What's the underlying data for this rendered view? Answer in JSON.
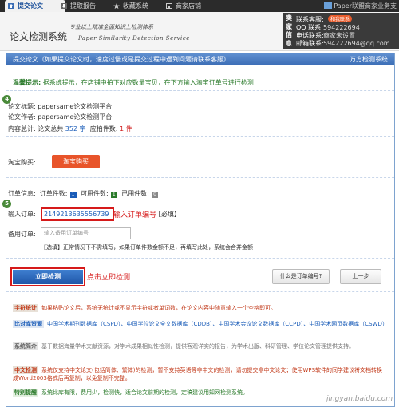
{
  "topbar": {
    "tabs": [
      {
        "label": "提交论文",
        "icon": "upload-icon",
        "active": true
      },
      {
        "label": "提取报告",
        "icon": "download-icon",
        "active": false
      },
      {
        "label": "收藏系统",
        "icon": "star-icon",
        "active": false
      },
      {
        "label": "商家店铺",
        "icon": "shop-icon",
        "active": false
      }
    ],
    "brand": "Paper联盟商家业务支"
  },
  "header": {
    "site_name": "论文检测系统",
    "slogan_cn": "专业以上精准全面知识上检测体系",
    "slogan_en": "Paper Similarity Detection Service",
    "contact": {
      "side_label": "卖家信息",
      "badge": "和我联系",
      "rows": [
        {
          "key": "联系客服:",
          "value": ""
        },
        {
          "key": "QQ 联系:",
          "value": "594222694"
        },
        {
          "key": "电话联系:",
          "value": "商家未设置"
        },
        {
          "key": "邮箱联系:",
          "value": "594222694@qq.com"
        }
      ]
    }
  },
  "panel": {
    "title": "提交论文（如果提交论文时，速度过慢或是提交过程中遇到问题请联系客服）",
    "right_label": "万方检测系统",
    "warm_tip_tag": "温馨提示:",
    "warm_tip_text": "据系统提示，在店铺中拍下对应数量宝贝，在下方输入淘宝订单号进行检测",
    "step4": "4",
    "step5": "5",
    "paper_title_label": "论文标题:",
    "paper_title_value": "papersame论文检测平台",
    "paper_author_label": "论文作者:",
    "paper_author_value": "papersame论文检测平台",
    "content_total_label": "内容总计:",
    "content_total_prefix": "论文总共",
    "content_total_chars": "352",
    "content_total_unit": "字",
    "pieces_label": "应拍件数:",
    "pieces_value": "1",
    "pieces_unit": "件",
    "taobao_label": "淘宝购买:",
    "taobao_button": "淘宝购买",
    "order_info_label": "订单信息:",
    "order_count_label": "订单件数:",
    "order_count": "1",
    "usable_label": "可用件数:",
    "usable_count": "1",
    "used_label": "已用件数:",
    "used_count": "0",
    "order_input_label": "输入订单:",
    "order_input_value": "2149213635556739",
    "order_input_hint": "输入订单编号",
    "order_required": "【必填】",
    "memo_label": "备用订单:",
    "memo_placeholder": "输入备用订单编号",
    "memo_note": "【选填】正常情况下不需填写，如果订单件数金额不足，再填写此处，系统会合并金额",
    "check_button": "立即检测",
    "check_hint": "点击立即检测",
    "what_button": "什么是订单编号?",
    "prev_button": "上一步"
  },
  "info": [
    {
      "tag": "字符统计",
      "text": "如果粘贴论文后，系统无统计或不显示字符或者单词数，在论文内容中随意输入一个空格即可。",
      "style": "red"
    },
    {
      "tag": "比对库资源",
      "text": "中国学术期刊数据库（CSPD）、中国学位论文全文数据库（CDDB）、中国学术会议论文数据库（CCPD）、中国学术网页数据库（CSWD）",
      "style": "blue"
    },
    {
      "tag": "系统简介",
      "text": "基于数据海量学术文献资源，对学术成果相似性检测，提供客观详实的报告，为学术出版、科研管理、学位论文管理提供支持。",
      "style": "gray"
    },
    {
      "tag": "中文检测",
      "text": "系统仅支持中文论文(包括简体、繁体)的检测，暂不支持英语等非中文的检测，请勿提交非中文论文；使用WPS软件的同学建议将文档转换成Word2003格式后再复制，以免复制不完整。",
      "style": "red"
    },
    {
      "tag": "特别提醒",
      "text": "系统比库有限，费用少，检测快，适合论文前期的检测，定稿建议用知网检测系统。",
      "style": "green"
    }
  ],
  "watermark": "jingyan.baidu.com",
  "colors": {
    "accent_blue": "#3b6db5",
    "highlight_red": "#d61a1a",
    "buy_orange": "#e8542a",
    "tip_green": "#2a7a2a"
  }
}
